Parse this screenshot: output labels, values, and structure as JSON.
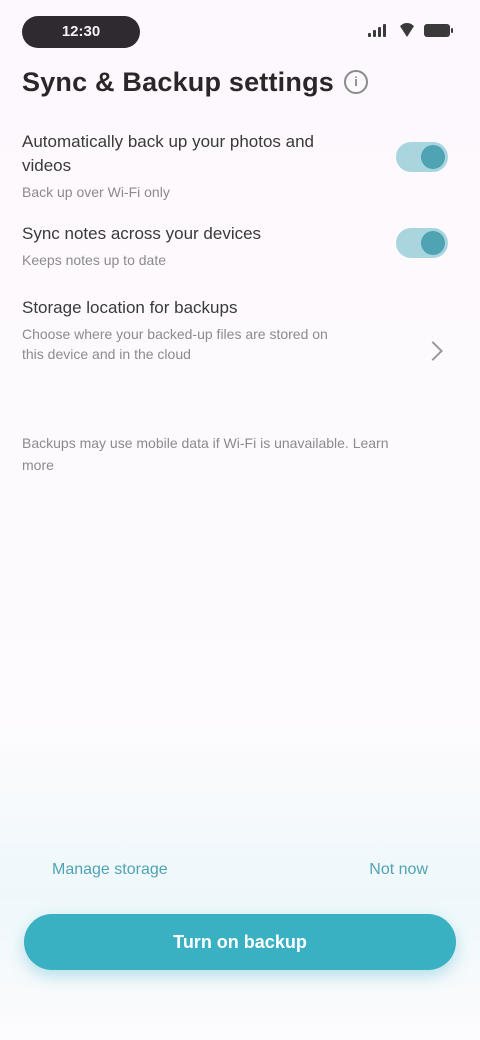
{
  "status_bar": {
    "time": "12:30",
    "signal_icon": "signal-icon",
    "wifi_icon": "wifi-icon",
    "battery_icon": "battery-icon"
  },
  "page": {
    "title": "Sync & Backup settings",
    "info_icon": "info-icon",
    "info_glyph": "i"
  },
  "settings": [
    {
      "title": "Automatically back up your photos and videos",
      "description": "Back up over Wi‑Fi only",
      "control": "toggle",
      "checked": true
    },
    {
      "title": "Sync notes across your devices",
      "description": "Keeps notes up to date",
      "control": "toggle",
      "checked": true
    },
    {
      "title": "Storage location for backups",
      "description": "Choose where your backed‑up files are stored on this device and in the cloud",
      "control": "chevron"
    }
  ],
  "footnote": "Backups may use mobile data if Wi‑Fi is unavailable. Learn more",
  "actions": {
    "secondary_left": "Manage storage",
    "secondary_right": "Not now",
    "primary": "Turn on backup"
  },
  "colors": {
    "accent": "#3ab0c3",
    "toggle_track": "#a9d6de",
    "toggle_knob": "#4fa3b3",
    "background": "#fdf9fd"
  }
}
